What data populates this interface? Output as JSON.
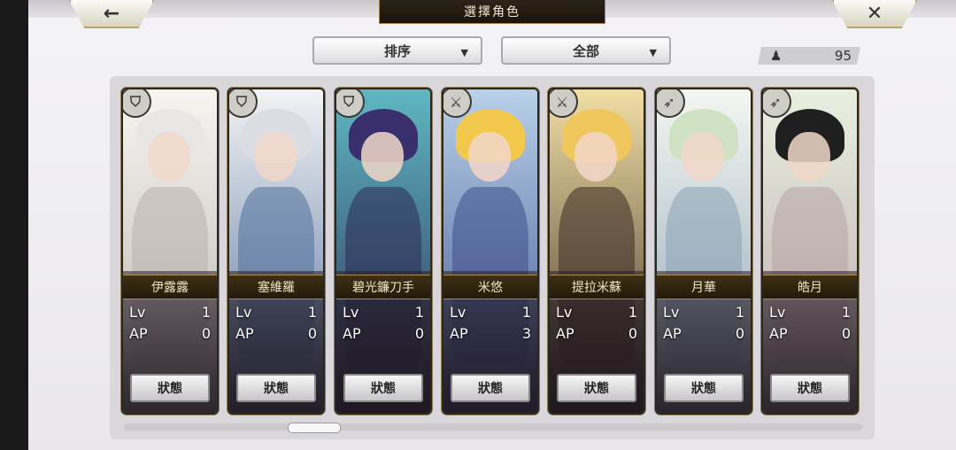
{
  "header": {
    "title": "選擇角色",
    "back_icon": "←",
    "close_icon": "✕"
  },
  "filters": {
    "sort_label": "排序",
    "filter_label": "全部",
    "caret": "▼"
  },
  "roster": {
    "count": "95",
    "person_icon": "♟"
  },
  "stat_labels": {
    "lv": "Lv",
    "ap": "AP"
  },
  "status_label": "狀態",
  "characters": [
    {
      "name": "伊露露",
      "lv": "1",
      "ap": "0",
      "weapon_icon": "shield",
      "colors": {
        "hair": "#e9e6e6",
        "body": "#b9b3ad",
        "bg": "#f7f4f1"
      }
    },
    {
      "name": "塞維羅",
      "lv": "1",
      "ap": "0",
      "weapon_icon": "shield",
      "colors": {
        "hair": "#dcdde2",
        "body": "#4f6f9a",
        "bg": "#f3f3f5"
      }
    },
    {
      "name": "碧光鐮刀手",
      "lv": "1",
      "ap": "0",
      "weapon_icon": "shield",
      "colors": {
        "hair": "#3a2f6d",
        "body": "#2c2a52",
        "bg": "#5fb7c2"
      }
    },
    {
      "name": "米悠",
      "lv": "1",
      "ap": "3",
      "weapon_icon": "sword",
      "colors": {
        "hair": "#f2c94c",
        "body": "#3e4f8c",
        "bg": "#b9d1e9"
      }
    },
    {
      "name": "提拉米蘇",
      "lv": "1",
      "ap": "0",
      "weapon_icon": "sword",
      "colors": {
        "hair": "#f0c75c",
        "body": "#3b2b24",
        "bg": "#f2dfa5"
      }
    },
    {
      "name": "月華",
      "lv": "1",
      "ap": "0",
      "weapon_icon": "bow",
      "colors": {
        "hair": "#cfe3c2",
        "body": "#8aa0b5",
        "bg": "#f4f7f2"
      }
    },
    {
      "name": "皓月",
      "lv": "1",
      "ap": "0",
      "weapon_icon": "bow",
      "colors": {
        "hair": "#1f1f1f",
        "body": "#b8a4a6",
        "bg": "#e9f0e0"
      }
    }
  ]
}
